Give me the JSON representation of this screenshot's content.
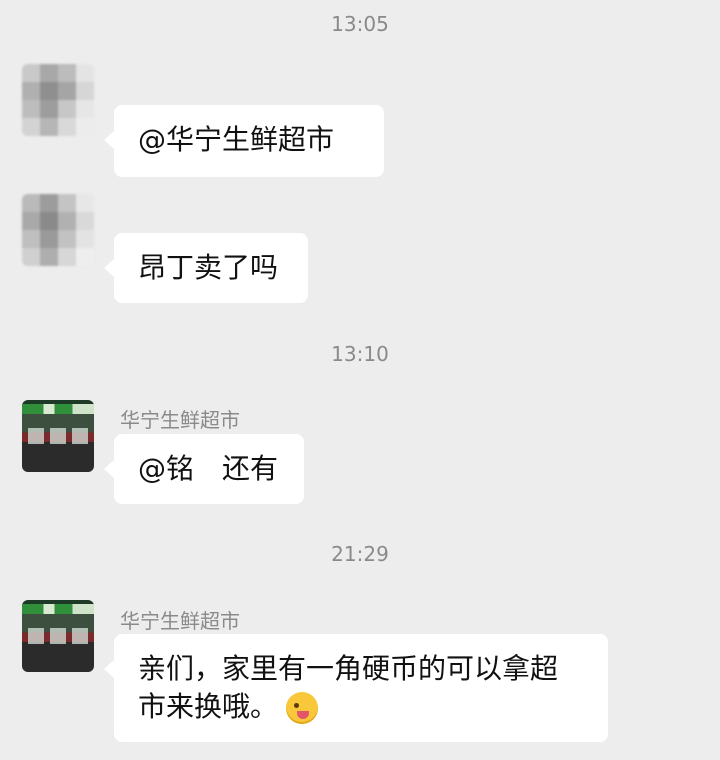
{
  "messages": {
    "t1": "13:05",
    "m1_text": "@华宁生鲜超市",
    "m2_text": "昂丁卖了吗",
    "t2": "13:10",
    "m3_sender": "华宁生鲜超市",
    "m3_text": "@铭　还有",
    "t3": "21:29",
    "m4_sender": "华宁生鲜超市",
    "m4_text": "亲们，家里有一角硬币的可以拿超市来换哦。"
  },
  "icons": {
    "emoji": "winking-face-with-tongue-emoji"
  }
}
